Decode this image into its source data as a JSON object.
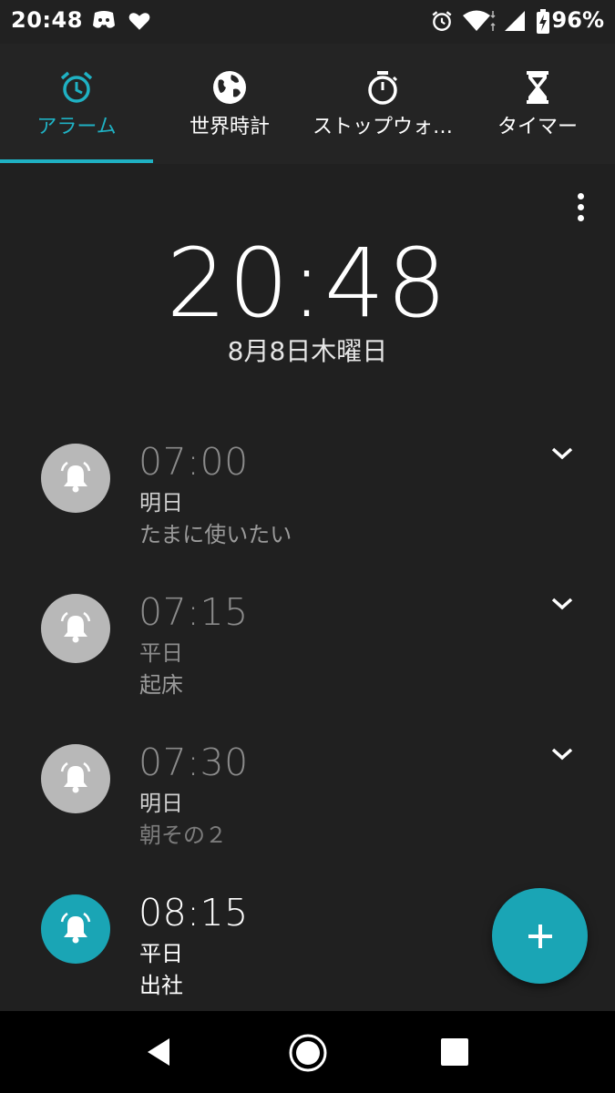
{
  "status_bar": {
    "time": "20:48",
    "battery_percent": "96%",
    "icons": [
      "discord-icon",
      "heart-icon",
      "alarm-icon",
      "wifi-icon",
      "cell-signal-icon",
      "battery-charging-icon"
    ]
  },
  "tabs": [
    {
      "label": "アラーム",
      "icon": "alarm-clock-icon",
      "active": true
    },
    {
      "label": "世界時計",
      "icon": "globe-icon",
      "active": false
    },
    {
      "label": "ストップウォ…",
      "icon": "stopwatch-icon",
      "active": false
    },
    {
      "label": "タイマー",
      "icon": "hourglass-icon",
      "active": false
    }
  ],
  "clock": {
    "time": "20:48",
    "date": "8月8日木曜日"
  },
  "alarms": [
    {
      "time": "07:00",
      "days": "明日",
      "label": "たまに使いたい",
      "enabled": false
    },
    {
      "time": "07:15",
      "days": "平日",
      "label": "起床",
      "enabled": false
    },
    {
      "time": "07:30",
      "days": "明日",
      "label": "朝その２",
      "enabled": false
    },
    {
      "time": "08:15",
      "days": "平日",
      "label": "出社",
      "enabled": true
    }
  ],
  "colors": {
    "accent": "#1fb1c3",
    "fab": "#1aa5b5",
    "background": "#202020",
    "tabbar": "#242424"
  }
}
